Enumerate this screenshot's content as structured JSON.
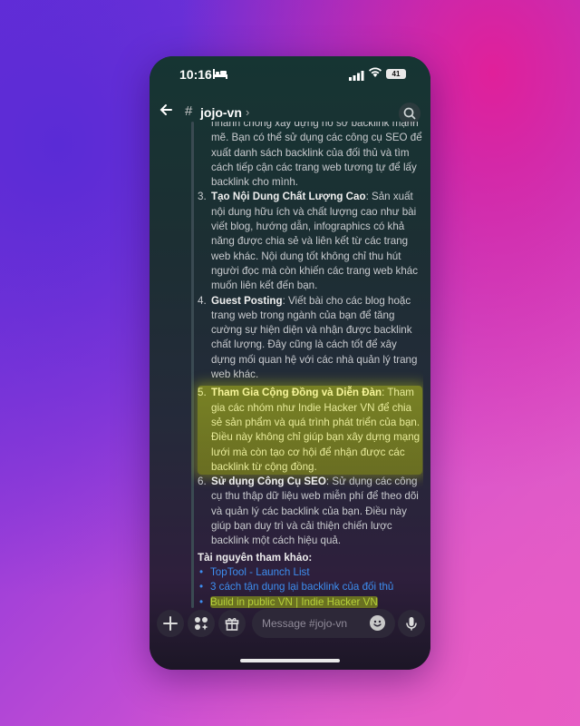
{
  "status": {
    "time": "10:16",
    "battery": "41"
  },
  "header": {
    "channel": "jojo-vn"
  },
  "content": {
    "intro_lines": "nhanh chóng xây dựng hồ sơ backlink mạnh mẽ. Bạn có thể sử dụng các công cụ SEO để xuất danh sách backlink của đối thủ và tìm cách tiếp cận các trang web tương tự để lấy backlink cho mình.",
    "items": [
      {
        "num": "3.",
        "title": "Tạo Nội Dung Chất Lượng Cao",
        "text": ": Sản xuất nội dung hữu ích và chất lượng cao như bài viết blog, hướng dẫn, infographics có khả năng được chia sẻ và liên kết từ các trang web khác. Nội dung tốt không chỉ thu hút người đọc mà còn khiến các trang web khác muốn liên kết đến bạn."
      },
      {
        "num": "4.",
        "title": "Guest Posting",
        "text": ": Viết bài cho các blog hoặc trang web trong ngành của bạn để tăng cường sự hiện diện và nhận được backlink chất lượng. Đây cũng là cách tốt để xây dựng mối quan hệ với các nhà quản lý trang web khác."
      },
      {
        "num": "5.",
        "title": "Tham Gia Cộng Đồng và Diễn Đàn",
        "text": ": Tham gia các nhóm như Indie Hacker VN để chia sẻ sản phẩm và quá trình phát triển của bạn. Điều này không chỉ giúp bạn xây dựng mạng lưới mà còn tạo cơ hội để nhận được các backlink từ cộng đồng."
      },
      {
        "num": "6.",
        "title": "Sử dụng Công Cụ SEO",
        "text": ": Sử dụng các công cụ thu thập dữ liệu web miễn phí để theo dõi và quản lý các backlink của bạn. Điều này giúp bạn duy trì và cải thiện chiến lược backlink một cách hiệu quả."
      }
    ],
    "resources_title": "Tài nguyên tham khảo:",
    "links": [
      "TopTool - Launch List",
      "3 cách tận dụng lại backlink của đối thủ",
      "Build in public VN | Indie Hacker VN"
    ]
  },
  "composer": {
    "placeholder": "Message #jojo-vn"
  },
  "colors": {
    "link": "#3d8ef0",
    "highlight": "#c8cf1a"
  }
}
